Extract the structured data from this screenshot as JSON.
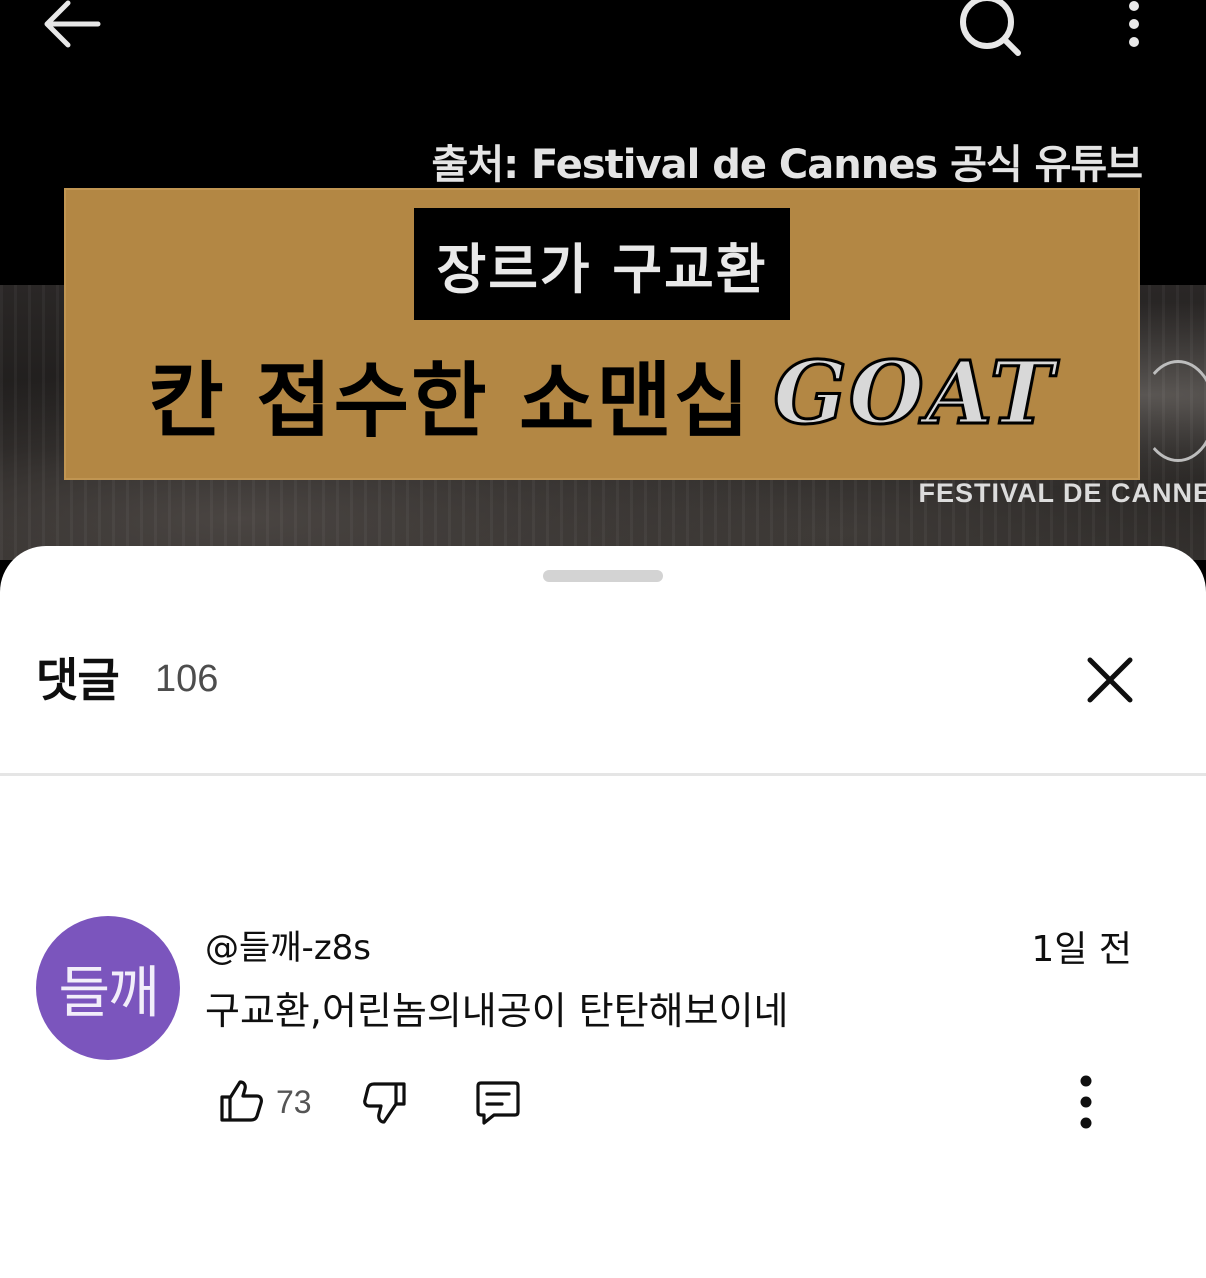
{
  "video": {
    "source_caption": "출처: Festival de Cannes 공식 유튜브",
    "banner_tag": "장르가 구교환",
    "banner_title": "칸 접수한 쇼맨십",
    "banner_title_highlight": "GOAT",
    "watermark": "FESTIVAL DE CANNE",
    "banner_color": "#b38744"
  },
  "top_bar": {
    "back_icon": "arrow-left-icon",
    "search_icon": "search-icon",
    "more_icon": "more-vertical-icon"
  },
  "comments_sheet": {
    "title": "댓글",
    "count": "106",
    "close_icon": "close-icon"
  },
  "comments": [
    {
      "avatar_text": "들깨",
      "avatar_color": "#7b55bd",
      "author": "@들깨-z8s",
      "time": "1일 전",
      "text": "구교환,어린놈의내공이 탄탄해보이네",
      "likes": "73"
    }
  ]
}
